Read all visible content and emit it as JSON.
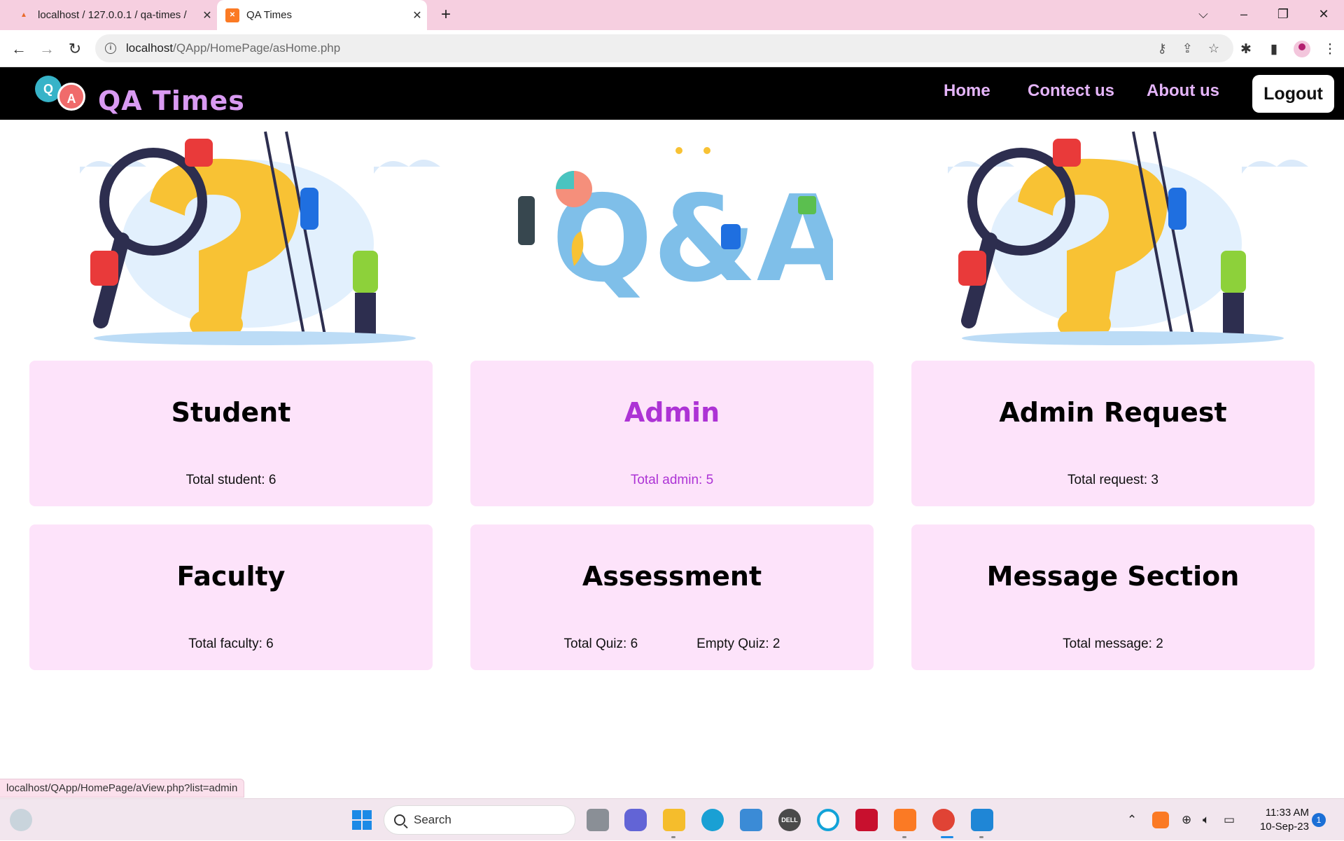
{
  "browser": {
    "tabs": [
      {
        "title": "localhost / 127.0.0.1 / qa-times /",
        "favicon": "pma-icon",
        "active": false
      },
      {
        "title": "QA Times",
        "favicon": "xampp-icon",
        "active": true
      }
    ],
    "url_host": "localhost",
    "url_path": "/QApp/HomePage/asHome.php"
  },
  "site": {
    "logo_q": "Q",
    "logo_a": "A",
    "brand": "QA Times",
    "nav": [
      "Home",
      "Contect us",
      "About us"
    ],
    "logout_label": "Logout",
    "banner_mid_text": "Q&A"
  },
  "cards": {
    "student": {
      "title": "Student",
      "stat": "Total student: 6"
    },
    "admin": {
      "title": "Admin",
      "stat": "Total admin: 5"
    },
    "admin_request": {
      "title": "Admin Request",
      "stat": "Total request: 3"
    },
    "faculty": {
      "title": "Faculty",
      "stat": "Total faculty: 6"
    },
    "assessment": {
      "title": "Assessment",
      "stat_quiz": "Total Quiz: 6",
      "stat_empty": "Empty Quiz: 2"
    },
    "message": {
      "title": "Message Section",
      "stat": "Total message: 2"
    }
  },
  "status_url": "localhost/QApp/HomePage/aView.php?list=admin",
  "taskbar": {
    "search_label": "Search",
    "time": "11:33 AM",
    "date": "10-Sep-23",
    "notification_count": "1",
    "dell_label": "DELL"
  },
  "colors": {
    "tabstrip": "#f6cfe0",
    "navbar": "#000000",
    "nav_link": "#e4b4f8",
    "card_bg": "#fde3fa",
    "active_accent": "#ad33d5"
  }
}
